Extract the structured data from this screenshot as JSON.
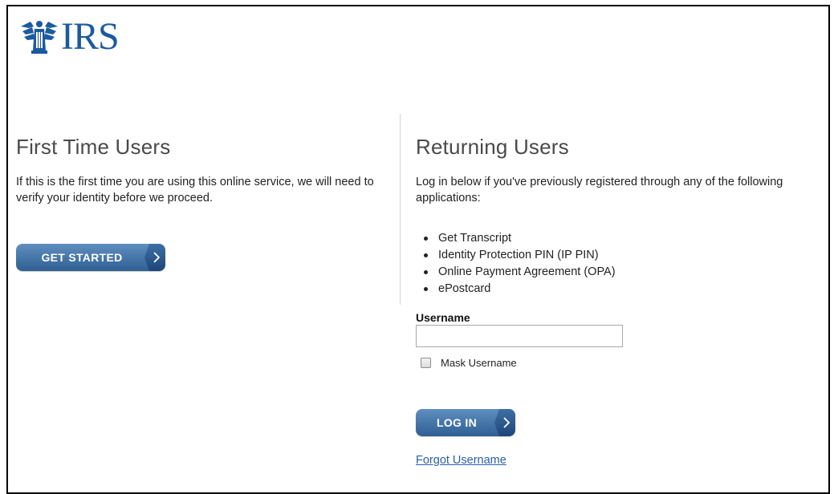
{
  "header": {
    "logo_text": "IRS"
  },
  "first_time": {
    "title": "First Time Users",
    "description": "If this is the first time you are using this online service, we will need to verify your identity before we proceed.",
    "button_label": "GET STARTED"
  },
  "returning": {
    "title": "Returning Users",
    "description": "Log in below if you've previously registered through any of the following applications:",
    "applications": [
      "Get Transcript",
      "Identity Protection PIN (IP PIN)",
      "Online Payment Agreement (OPA)",
      "ePostcard"
    ],
    "username_label": "Username",
    "username_value": "",
    "mask_label": "Mask Username",
    "mask_checked": false,
    "login_label": "LOG IN",
    "forgot_label": "Forgot Username"
  },
  "colors": {
    "logo_blue": "#1c5a9e",
    "button_blue": "#3a6ea5",
    "link_blue": "#2a5ea6"
  },
  "icons": {
    "logo": "irs-eagle-logo-icon",
    "button_arrow": "chevron-right-icon"
  }
}
